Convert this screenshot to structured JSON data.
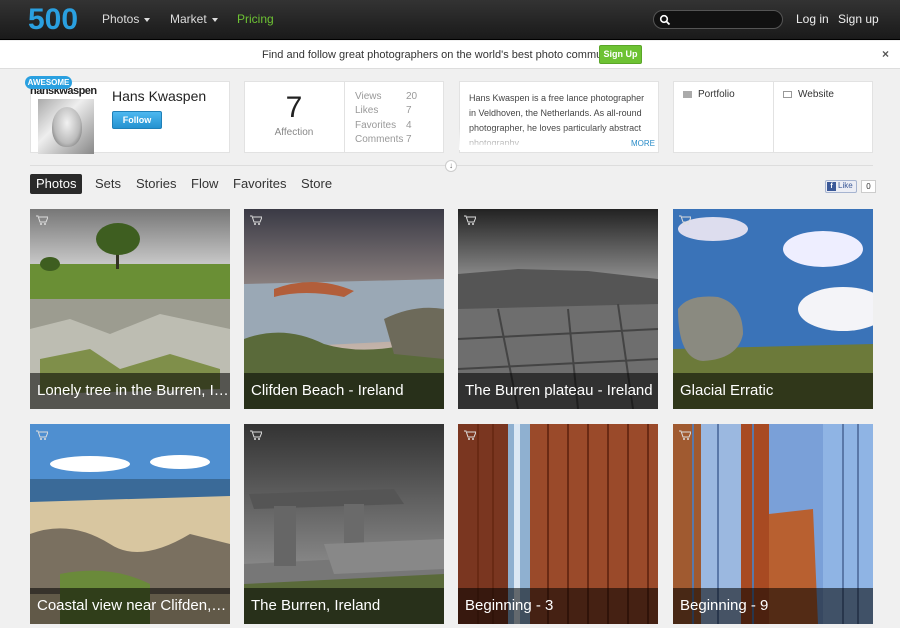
{
  "nav": {
    "logo": "500",
    "photos": "Photos",
    "market": "Market",
    "pricing": "Pricing",
    "search_placeholder": "",
    "login": "Log in",
    "signup": "Sign up"
  },
  "banner": {
    "text": "Find and follow great photographers on the world's best photo community.",
    "signup": "Sign Up",
    "close": "×"
  },
  "profile": {
    "badge": "AWESOME",
    "logo_text": "hanskwaspen",
    "name": "Hans Kwaspen",
    "follow": "Follow"
  },
  "affection": {
    "value": "7",
    "label": "Affection"
  },
  "stats": [
    {
      "label": "Views",
      "value": "20"
    },
    {
      "label": "Likes",
      "value": "7"
    },
    {
      "label": "Favorites",
      "value": "4"
    },
    {
      "label": "Comments",
      "value": "7"
    }
  ],
  "bio": {
    "text": "Hans Kwaspen is a free lance photographer in Veldhoven, the Netherlands. As all-round photographer, he loves particularly abstract photography",
    "more": "MORE"
  },
  "links": {
    "portfolio": "Portfolio",
    "website": "Website"
  },
  "tabs": [
    "Photos",
    "Sets",
    "Stories",
    "Flow",
    "Favorites",
    "Store"
  ],
  "facebook": {
    "like": "Like",
    "count": "0"
  },
  "photos": [
    {
      "title": "Lonely tree in the Burren, Ireland"
    },
    {
      "title": "Clifden Beach - Ireland"
    },
    {
      "title": "The Burren plateau - Ireland"
    },
    {
      "title": "Glacial Erratic"
    },
    {
      "title": "Coastal view near Clifden, Ireland"
    },
    {
      "title": "The Burren, Ireland"
    },
    {
      "title": "Beginning - 3"
    },
    {
      "title": "Beginning - 9"
    }
  ],
  "colors": {
    "accent_blue": "#2aa0e0",
    "accent_green": "#6dc233"
  }
}
